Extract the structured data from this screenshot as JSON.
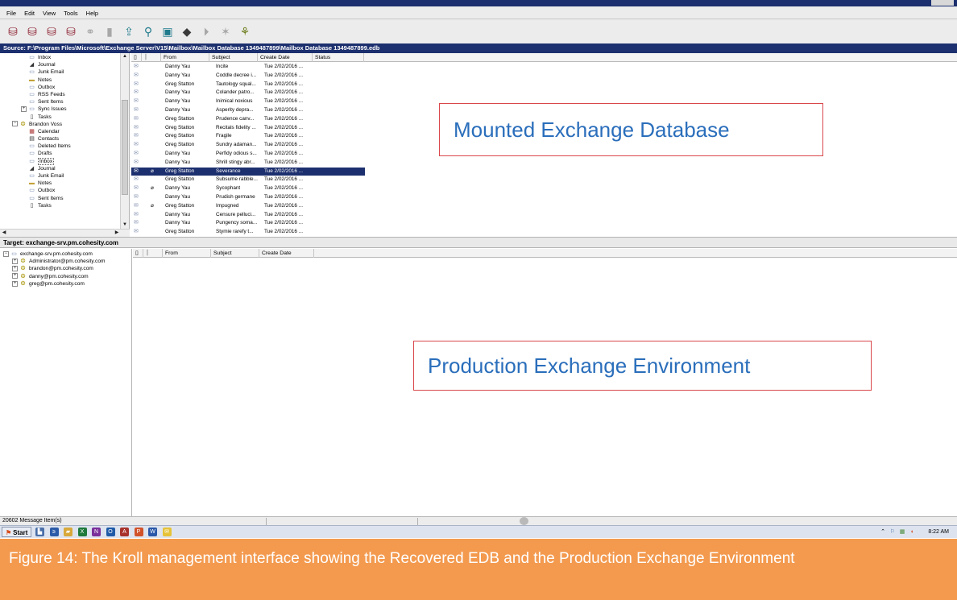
{
  "menu": [
    "File",
    "Edit",
    "View",
    "Tools",
    "Help"
  ],
  "toolbar_icons": [
    {
      "icon": "database-open-icon",
      "glyph": "⛁",
      "tone": "db"
    },
    {
      "icon": "database-add-icon",
      "glyph": "⛁",
      "tone": "db"
    },
    {
      "icon": "database-target-icon",
      "glyph": "⛁",
      "tone": "db"
    },
    {
      "icon": "database-close-icon",
      "glyph": "⛁",
      "tone": "db"
    },
    {
      "icon": "link-icon",
      "glyph": "⚭",
      "tone": "grey"
    },
    {
      "icon": "bookmark-icon",
      "glyph": "▮",
      "tone": "grey"
    },
    {
      "icon": "export-icon",
      "glyph": "⇪",
      "tone": "teal"
    },
    {
      "icon": "search-icon",
      "glyph": "⚲",
      "tone": "teal"
    },
    {
      "icon": "document-search-icon",
      "glyph": "▣",
      "tone": "teal"
    },
    {
      "icon": "stack-icon",
      "glyph": "◆",
      "tone": "ink"
    },
    {
      "icon": "filter-icon",
      "glyph": "⏵",
      "tone": "grey"
    },
    {
      "icon": "wand-icon",
      "glyph": "✶",
      "tone": "grey"
    },
    {
      "icon": "people-icon",
      "glyph": "⚘",
      "tone": "olive"
    }
  ],
  "source": {
    "path": "Source: F:\\Program Files\\Microsoft\\Exchange Server\\V15\\Mailbox\\Mailbox Database 1349487899\\Mailbox Database 1349487899.edb"
  },
  "source_tree": [
    {
      "label": "Inbox",
      "icon": "folder-icon",
      "glyph": "▭",
      "tone": "fold",
      "indent": 2
    },
    {
      "label": "Journal",
      "icon": "journal-icon",
      "glyph": "◢",
      "tone": "dark",
      "indent": 2
    },
    {
      "label": "Junk Email",
      "icon": "folder-icon",
      "glyph": "▭",
      "tone": "fold",
      "indent": 2
    },
    {
      "label": "Notes",
      "icon": "notes-icon",
      "glyph": "▬",
      "tone": "gold",
      "indent": 2
    },
    {
      "label": "Outbox",
      "icon": "folder-icon",
      "glyph": "▭",
      "tone": "fold",
      "indent": 2
    },
    {
      "label": "RSS Feeds",
      "icon": "folder-icon",
      "glyph": "▭",
      "tone": "fold",
      "indent": 2
    },
    {
      "label": "Sent Items",
      "icon": "folder-icon",
      "glyph": "▭",
      "tone": "fold",
      "indent": 2
    },
    {
      "label": "Sync Issues",
      "icon": "folder-icon",
      "glyph": "▭",
      "tone": "fold",
      "indent": 2,
      "expander": "+"
    },
    {
      "label": "Tasks",
      "icon": "tasks-icon",
      "glyph": "▯",
      "tone": "dark",
      "indent": 2
    },
    {
      "label": "Brandon Voss",
      "icon": "user-icon",
      "glyph": "❂",
      "tone": "user",
      "indent": 1,
      "expander": "−"
    },
    {
      "label": "Calendar",
      "icon": "calendar-icon",
      "glyph": "▦",
      "tone": "red",
      "indent": 2
    },
    {
      "label": "Contacts",
      "icon": "contacts-icon",
      "glyph": "▤",
      "tone": "dark",
      "indent": 2
    },
    {
      "label": "Deleted Items",
      "icon": "folder-icon",
      "glyph": "▭",
      "tone": "fold",
      "indent": 2
    },
    {
      "label": "Drafts",
      "icon": "folder-icon",
      "glyph": "▭",
      "tone": "fold",
      "indent": 2
    },
    {
      "label": "Inbox",
      "icon": "folder-icon",
      "glyph": "▭",
      "tone": "fold",
      "indent": 2,
      "boxed": true
    },
    {
      "label": "Journal",
      "icon": "journal-icon",
      "glyph": "◢",
      "tone": "dark",
      "indent": 2
    },
    {
      "label": "Junk Email",
      "icon": "folder-icon",
      "glyph": "▭",
      "tone": "fold",
      "indent": 2
    },
    {
      "label": "Notes",
      "icon": "notes-icon",
      "glyph": "▬",
      "tone": "gold",
      "indent": 2
    },
    {
      "label": "Outbox",
      "icon": "folder-icon",
      "glyph": "▭",
      "tone": "fold",
      "indent": 2
    },
    {
      "label": "Sent Items",
      "icon": "folder-icon",
      "glyph": "▭",
      "tone": "fold",
      "indent": 2
    },
    {
      "label": "Tasks",
      "icon": "tasks-icon",
      "glyph": "▯",
      "tone": "dark",
      "indent": 2
    }
  ],
  "source_grid": {
    "columns": [
      {
        "key": "type",
        "label": "▯"
      },
      {
        "key": "attach",
        "label": "⏐"
      },
      {
        "key": "from",
        "label": "From"
      },
      {
        "key": "subject",
        "label": "Subject"
      },
      {
        "key": "date",
        "label": "Create Date"
      },
      {
        "key": "status",
        "label": "Status"
      }
    ],
    "rows": [
      {
        "from": "Danny Yau",
        "subject": "Incite",
        "date": "Tue 2/02/2016 ...",
        "attach": false
      },
      {
        "from": "Danny Yau",
        "subject": "Coddle decree i...",
        "date": "Tue 2/02/2016 ...",
        "attach": false
      },
      {
        "from": "Greg Statton",
        "subject": "Tautology squal...",
        "date": "Tue 2/02/2016 ...",
        "attach": false
      },
      {
        "from": "Danny Yau",
        "subject": "Colander patro...",
        "date": "Tue 2/02/2016 ...",
        "attach": false
      },
      {
        "from": "Danny Yau",
        "subject": "Inimical noxious",
        "date": "Tue 2/02/2016 ...",
        "attach": false
      },
      {
        "from": "Danny Yau",
        "subject": "Asperity depra...",
        "date": "Tue 2/02/2016 ...",
        "attach": false
      },
      {
        "from": "Greg Statton",
        "subject": "Prudence canv...",
        "date": "Tue 2/02/2016 ...",
        "attach": false
      },
      {
        "from": "Greg Statton",
        "subject": "Recitals fidelity ...",
        "date": "Tue 2/02/2016 ...",
        "attach": false
      },
      {
        "from": "Greg Statton",
        "subject": "Fragile",
        "date": "Tue 2/02/2016 ...",
        "attach": false
      },
      {
        "from": "Greg Statton",
        "subject": "Sundry adaman...",
        "date": "Tue 2/02/2016 ...",
        "attach": false
      },
      {
        "from": "Danny Yau",
        "subject": "Perfidy odious s...",
        "date": "Tue 2/02/2016 ...",
        "attach": false
      },
      {
        "from": "Danny Yau",
        "subject": "Shrill stingy abr...",
        "date": "Tue 2/02/2016 ...",
        "attach": false
      },
      {
        "from": "Greg Statton",
        "subject": "Severance",
        "date": "Tue 2/02/2016 ...",
        "attach": true,
        "selected": true
      },
      {
        "from": "Greg Statton",
        "subject": "Subsume rabble...",
        "date": "Tue 2/02/2016 ...",
        "attach": false
      },
      {
        "from": "Danny Yau",
        "subject": "Sycophant",
        "date": "Tue 2/02/2016 ...",
        "attach": true
      },
      {
        "from": "Danny Yau",
        "subject": "Prudish germane",
        "date": "Tue 2/02/2016 ...",
        "attach": false
      },
      {
        "from": "Greg Statton",
        "subject": "Impugned",
        "date": "Tue 2/02/2016 ...",
        "attach": true
      },
      {
        "from": "Danny Yau",
        "subject": "Censure pelluci...",
        "date": "Tue 2/02/2016 ...",
        "attach": false
      },
      {
        "from": "Danny Yau",
        "subject": "Pungency soma...",
        "date": "Tue 2/02/2016 ...",
        "attach": false
      },
      {
        "from": "Greg Statton",
        "subject": "Stymie rarefy t...",
        "date": "Tue 2/02/2016 ...",
        "attach": false
      }
    ]
  },
  "target": {
    "label": "Target: exchange-srv.pm.cohesity.com"
  },
  "target_tree": [
    {
      "label": "exchange-srv.pm.cohesity.com",
      "icon": "server-icon",
      "glyph": "▭",
      "tone": "fold",
      "indent": 0,
      "expander": "−"
    },
    {
      "label": "Administrator@pm.cohesity.com",
      "icon": "user-icon",
      "glyph": "❂",
      "tone": "user",
      "indent": 1,
      "expander": "+"
    },
    {
      "label": "brandon@pm.cohesity.com",
      "icon": "user-icon",
      "glyph": "❂",
      "tone": "user",
      "indent": 1,
      "expander": "+"
    },
    {
      "label": "danny@pm.cohesity.com",
      "icon": "user-icon",
      "glyph": "❂",
      "tone": "user",
      "indent": 1,
      "expander": "+"
    },
    {
      "label": "greg@pm.cohesity.com",
      "icon": "user-icon",
      "glyph": "❂",
      "tone": "user",
      "indent": 1,
      "expander": "+"
    }
  ],
  "target_grid": {
    "columns": [
      {
        "key": "type",
        "label": "▯"
      },
      {
        "key": "attach",
        "label": "⏐"
      },
      {
        "key": "from",
        "label": "From"
      },
      {
        "key": "subject",
        "label": "Subject"
      },
      {
        "key": "date",
        "label": "Create Date"
      }
    ]
  },
  "callouts": {
    "source": "Mounted Exchange Database",
    "target": "Production Exchange Environment"
  },
  "status": {
    "message_count": "20602 Message Item(s)"
  },
  "taskbar": {
    "start": "Start",
    "clock": "8:22 AM",
    "apps": [
      {
        "icon": "server-manager-icon",
        "glyph": "▙",
        "color": "#4a6fa8"
      },
      {
        "icon": "powershell-icon",
        "glyph": "≥",
        "color": "#2b5aa8"
      },
      {
        "icon": "explorer-icon",
        "glyph": "▰",
        "color": "#d8a83a"
      },
      {
        "icon": "excel-icon",
        "glyph": "X",
        "color": "#1f7a3c"
      },
      {
        "icon": "onenote-icon",
        "glyph": "N",
        "color": "#7a2f9a"
      },
      {
        "icon": "outlook-icon",
        "glyph": "O",
        "color": "#1f5aa8"
      },
      {
        "icon": "access-icon",
        "glyph": "A",
        "color": "#a8322b"
      },
      {
        "icon": "powerpoint-icon",
        "glyph": "P",
        "color": "#d2522a"
      },
      {
        "icon": "word-icon",
        "glyph": "W",
        "color": "#2b57a8"
      },
      {
        "icon": "kroll-icon",
        "glyph": "✉",
        "color": "#e6c238"
      }
    ]
  },
  "caption": {
    "text": "Figure 14: The Kroll management interface showing the Recovered EDB and the Production Exchange Environment"
  },
  "colors": {
    "accent_navy": "#1c2f6e",
    "callout_border": "#d9474b",
    "callout_text": "#2a6ebb",
    "caption_bg": "#f39a4f"
  }
}
